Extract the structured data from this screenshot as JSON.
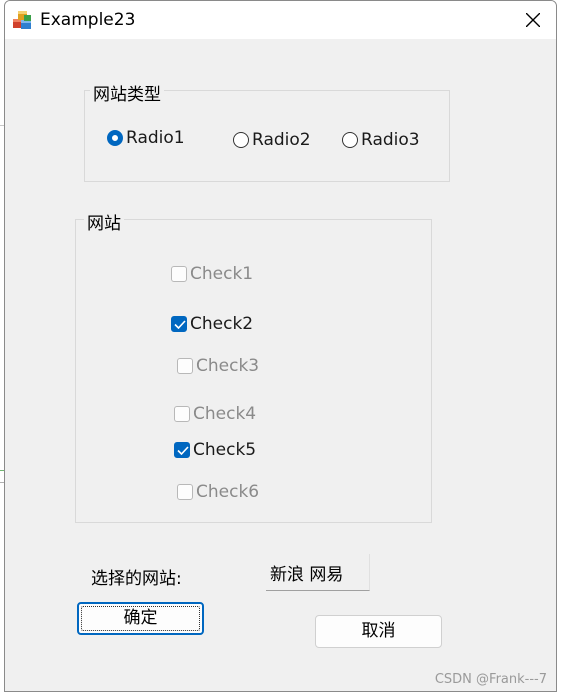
{
  "window": {
    "title": "Example23"
  },
  "radio_group": {
    "legend": "网站类型",
    "options": [
      {
        "label": "Radio1",
        "selected": true
      },
      {
        "label": "Radio2",
        "selected": false
      },
      {
        "label": "Radio3",
        "selected": false
      }
    ]
  },
  "check_group": {
    "legend": "网站",
    "items": [
      {
        "label": "Check1",
        "checked": false
      },
      {
        "label": "Check2",
        "checked": true
      },
      {
        "label": "Check3",
        "checked": false
      },
      {
        "label": "Check4",
        "checked": false
      },
      {
        "label": "Check5",
        "checked": true
      },
      {
        "label": "Check6",
        "checked": false
      }
    ]
  },
  "selection": {
    "label": "选择的网站:",
    "value": "新浪 网易"
  },
  "buttons": {
    "ok_label": "确定",
    "cancel_label": "取消"
  },
  "watermark": "CSDN @Frank---7",
  "colors": {
    "accent": "#0067c0",
    "dialog_bg": "#f0f0f0",
    "disabled_text": "#8a8a8a"
  },
  "icons": {
    "app": "app-cubes-icon",
    "close": "close-icon",
    "check": "checkmark-icon"
  }
}
